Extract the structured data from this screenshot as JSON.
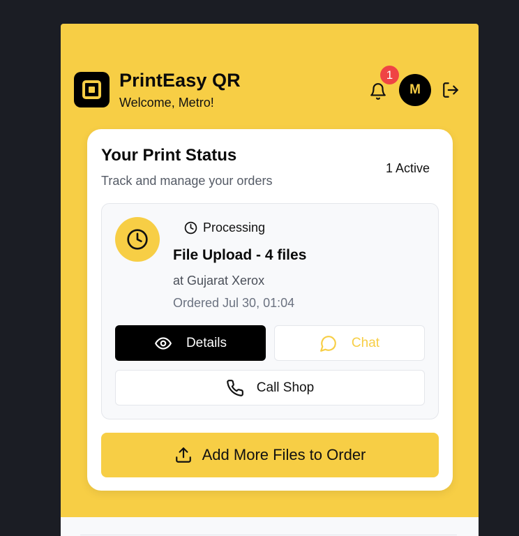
{
  "header": {
    "app_title": "PrintEasy QR",
    "welcome": "Welcome, Metro!",
    "notification_count": "1",
    "avatar_initial": "M",
    "icons": [
      "logo-icon",
      "bell-icon",
      "logout-icon"
    ]
  },
  "status_card": {
    "title": "Your Print Status",
    "subtitle": "Track and manage your orders",
    "active_count": "1 Active",
    "orders": [
      {
        "status": "Processing",
        "title": "File Upload - 4 files",
        "shop": "at Gujarat Xerox",
        "ordered": "Ordered Jul 30, 01:04",
        "details_label": "Details",
        "chat_label": "Chat",
        "call_label": "Call Shop"
      }
    ],
    "add_files_label": "Add More Files to Order"
  },
  "colors": {
    "accent": "#f7ce45",
    "background": "#1b1d24",
    "badge": "#ef4444",
    "dark": "#000000"
  }
}
